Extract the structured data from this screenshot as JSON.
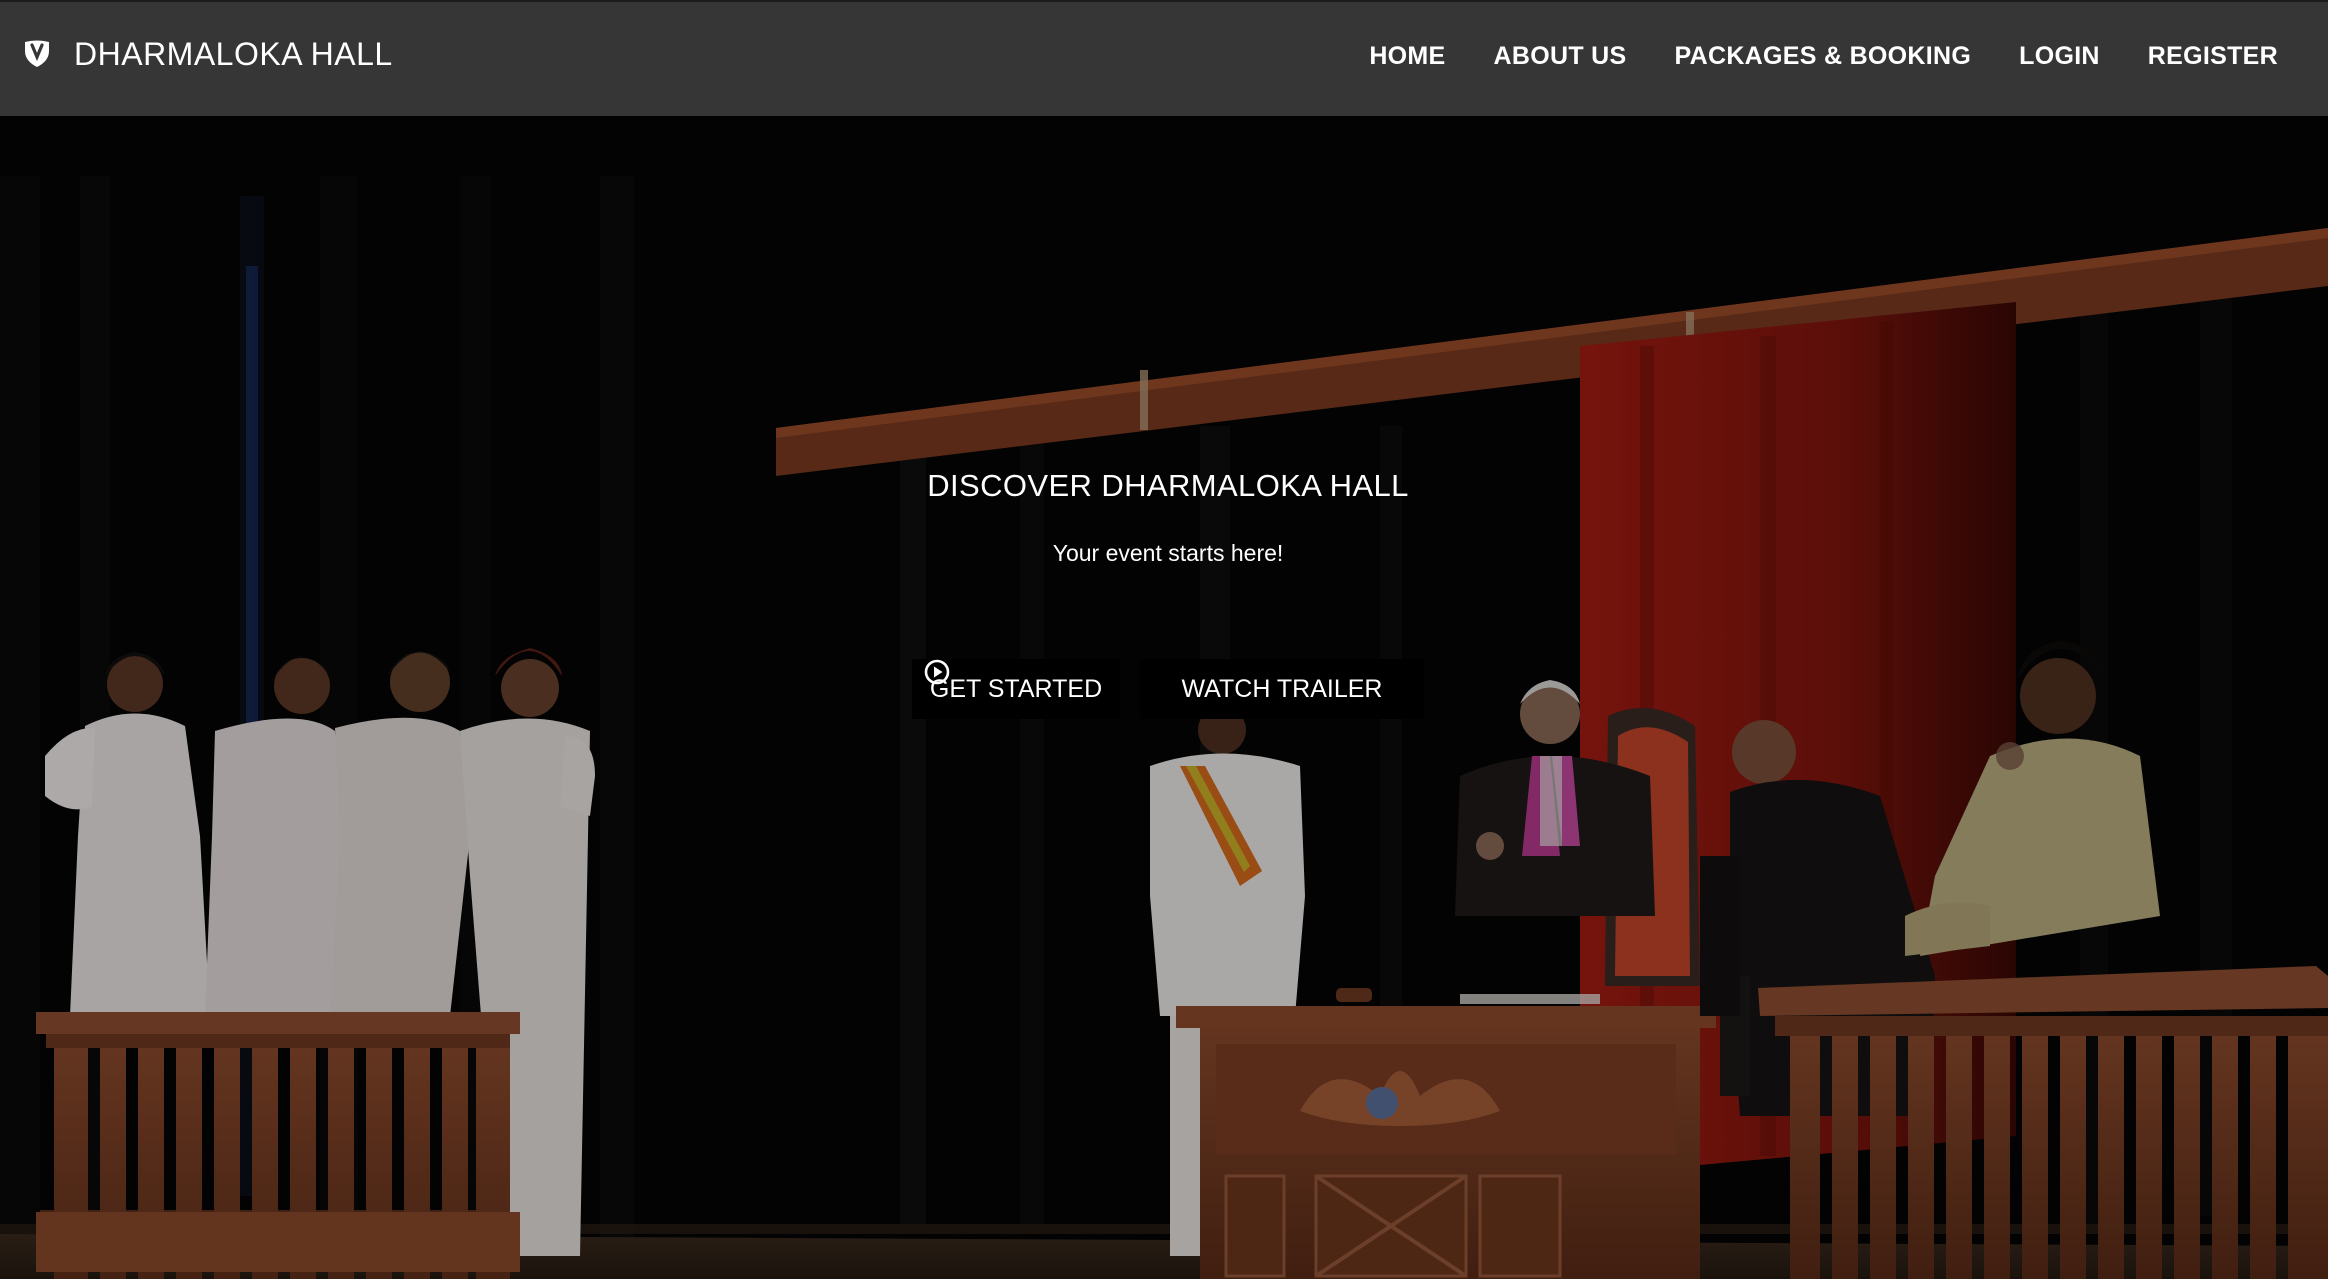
{
  "brand": {
    "title": "DHARMALOKA HALL",
    "icon": "pin-shield-icon"
  },
  "nav": {
    "items": [
      {
        "label": "HOME"
      },
      {
        "label": "ABOUT US"
      },
      {
        "label": "PACKAGES & BOOKING"
      },
      {
        "label": "LOGIN"
      },
      {
        "label": "REGISTER"
      }
    ]
  },
  "hero": {
    "title": "DISCOVER DHARMALOKA HALL",
    "subtitle": "Your event starts here!",
    "get_started_label": "GET STARTED",
    "watch_trailer_label": "WATCH TRAILER",
    "trailer_icon": "play-circle-icon",
    "background": "stage-courtroom-scene"
  },
  "colors": {
    "navbar_bg": "#363636",
    "button_bg": "#000000",
    "text": "#ffffff",
    "curtain_red": "#8e1a12",
    "wood": "#7a3c23"
  }
}
